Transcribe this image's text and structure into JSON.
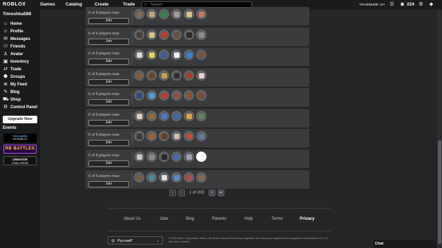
{
  "topbar": {
    "logo": "ROBLOX",
    "nav": [
      "Games",
      "Catalog",
      "Create",
      "Trade"
    ],
    "search_placeholder": "Search",
    "username": "TimoshkaS89: 13+",
    "robux": "224"
  },
  "sidebar": {
    "username": "Timoshka589",
    "items": [
      {
        "label": "Home",
        "icon": "home-icon",
        "glyph": "⌂"
      },
      {
        "label": "Profile",
        "icon": "profile-icon",
        "glyph": "☺"
      },
      {
        "label": "Messages",
        "icon": "messages-icon",
        "glyph": "✉"
      },
      {
        "label": "Friends",
        "icon": "friends-icon",
        "glyph": "⚇"
      },
      {
        "label": "Avatar",
        "icon": "avatar-icon",
        "glyph": "♙"
      },
      {
        "label": "Inventory",
        "icon": "inventory-icon",
        "glyph": "▣"
      },
      {
        "label": "Trade",
        "icon": "trade-icon",
        "glyph": "⇄"
      },
      {
        "label": "Groups",
        "icon": "groups-icon",
        "glyph": "⚈"
      },
      {
        "label": "My Feed",
        "icon": "feed-icon",
        "glyph": "≣"
      },
      {
        "label": "Blog",
        "icon": "blog-icon",
        "glyph": "✎"
      },
      {
        "label": "Shop",
        "icon": "shop-icon",
        "glyph": "⛟"
      },
      {
        "label": "Control Panel",
        "icon": "control-panel-icon",
        "glyph": "⚙"
      }
    ],
    "upgrade_label": "Upgrade Now",
    "events_label": "Events",
    "events": [
      {
        "line1": "THIS WEEK",
        "line2": "ON ROBLOX"
      },
      {
        "line1": "RB BATTLES"
      },
      {
        "line1": "CREATOR",
        "line2": "CHALLENGE"
      }
    ]
  },
  "servers": [
    {
      "players": "6 of 6 players max",
      "join": "Join",
      "avatar_colors": [
        "#8a6a4e",
        "#c8a27a",
        "#2b8a3e",
        "#a0a0a0",
        "#d9c28f",
        "#c97c5d"
      ]
    },
    {
      "players": "6 of 6 players max",
      "join": "Join",
      "avatar_colors": [
        "#4a3b2e",
        "#e0c48a",
        "#c0392b",
        "#6b4f3a",
        "#2c2c2c",
        "#8e8e8e"
      ]
    },
    {
      "players": "6 of 6 players max",
      "join": "Join",
      "avatar_colors": [
        "#d8d8d8",
        "#e6d65a",
        "#3a5aa8",
        "#f0f0f0",
        "#3b7dd8",
        "#7a5230"
      ]
    },
    {
      "players": "6 of 6 players max",
      "join": "Join",
      "avatar_colors": [
        "#8b5a3c",
        "#6b4423",
        "#c8a040",
        "#2e2e2e",
        "#b03a2e",
        "#e8d0d0"
      ]
    },
    {
      "players": "6 of 6 players max",
      "join": "Join",
      "avatar_colors": [
        "#2a4a8a",
        "#4aa0e0",
        "#c0392b",
        "#a04a3a",
        "#8a5030",
        "#7a4a2a"
      ]
    },
    {
      "players": "6 of 6 players max",
      "join": "Join",
      "avatar_colors": [
        "#e0d0c0",
        "#9a6a3a",
        "#4a7ad0",
        "#3a6ab0",
        "#e0a040",
        "#5a8a5a"
      ]
    },
    {
      "players": "6 of 6 players max",
      "join": "Join",
      "avatar_colors": [
        "#3a3a3a",
        "#a06030",
        "#6a3a20",
        "#d0c0b0",
        "#c04a3a",
        "#5a7aa0"
      ]
    },
    {
      "players": "6 of 6 players max",
      "join": "Join",
      "avatar_colors": [
        "#c8c8c8",
        "#8a8a8a",
        "#2a2a2a",
        "#4a6ab0",
        "#a0a0b0",
        "#ffffff"
      ]
    },
    {
      "players": "6 of 6 players max",
      "join": "Join",
      "avatar_colors": [
        "#7a5a3a",
        "#4a8aa0",
        "#e0e0e0",
        "#5a8ad0",
        "#b04a4a",
        "#8a6a4a"
      ]
    }
  ],
  "pagination": {
    "first": "«",
    "prev": "‹",
    "text": "1 of 203",
    "next": "›",
    "last": "»"
  },
  "footer": {
    "links": [
      "About Us",
      "Jobs",
      "Blog",
      "Parents",
      "Help",
      "Terms",
      "Privacy"
    ],
    "language": "Русский*",
    "copyright": "©2018 Roblox Corporation. Roblox, the Roblox logo and Powering Imagination are among our registered and unregistered trademarks in the U.S. and other countries."
  },
  "chat": {
    "label": "Chat"
  },
  "colors": {
    "background": "#232527",
    "panel": "#393b3d",
    "topbar": "#191b1d"
  }
}
